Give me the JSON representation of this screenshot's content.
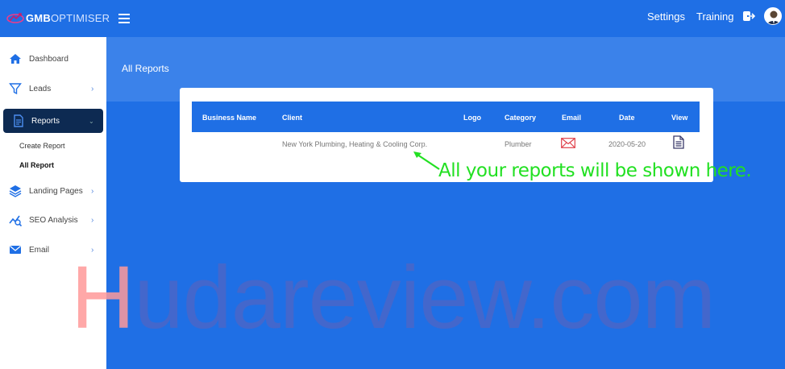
{
  "brand": {
    "bold": "GMB",
    "light": "OPTIMISER"
  },
  "topnav": {
    "settings": "Settings",
    "training": "Training"
  },
  "sidebar": {
    "items": [
      {
        "label": "Dashboard"
      },
      {
        "label": "Leads"
      },
      {
        "label": "Reports"
      },
      {
        "label": "Landing Pages"
      },
      {
        "label": "SEO Analysis"
      },
      {
        "label": "Email"
      }
    ],
    "sub": [
      {
        "label": "Create Report"
      },
      {
        "label": "All Report"
      }
    ],
    "chevron": "›"
  },
  "page": {
    "title": "All Reports"
  },
  "table": {
    "headers": [
      "Business Name",
      "Client",
      "Logo",
      "Category",
      "Email",
      "Date",
      "View"
    ],
    "rows": [
      {
        "business_name": "",
        "client": "New York Plumbing, Heating & Cooling Corp.",
        "logo": "",
        "category": "Plumber",
        "date": "2020-05-20"
      }
    ]
  },
  "callout": "All your reports will be shown here.",
  "watermark": {
    "first": "H",
    "rest": "udareview.com"
  },
  "colors": {
    "primary": "#1f6fe5",
    "sidebar_active": "#0d2a52",
    "callout": "#22e022",
    "email_icon": "#e0404a"
  }
}
